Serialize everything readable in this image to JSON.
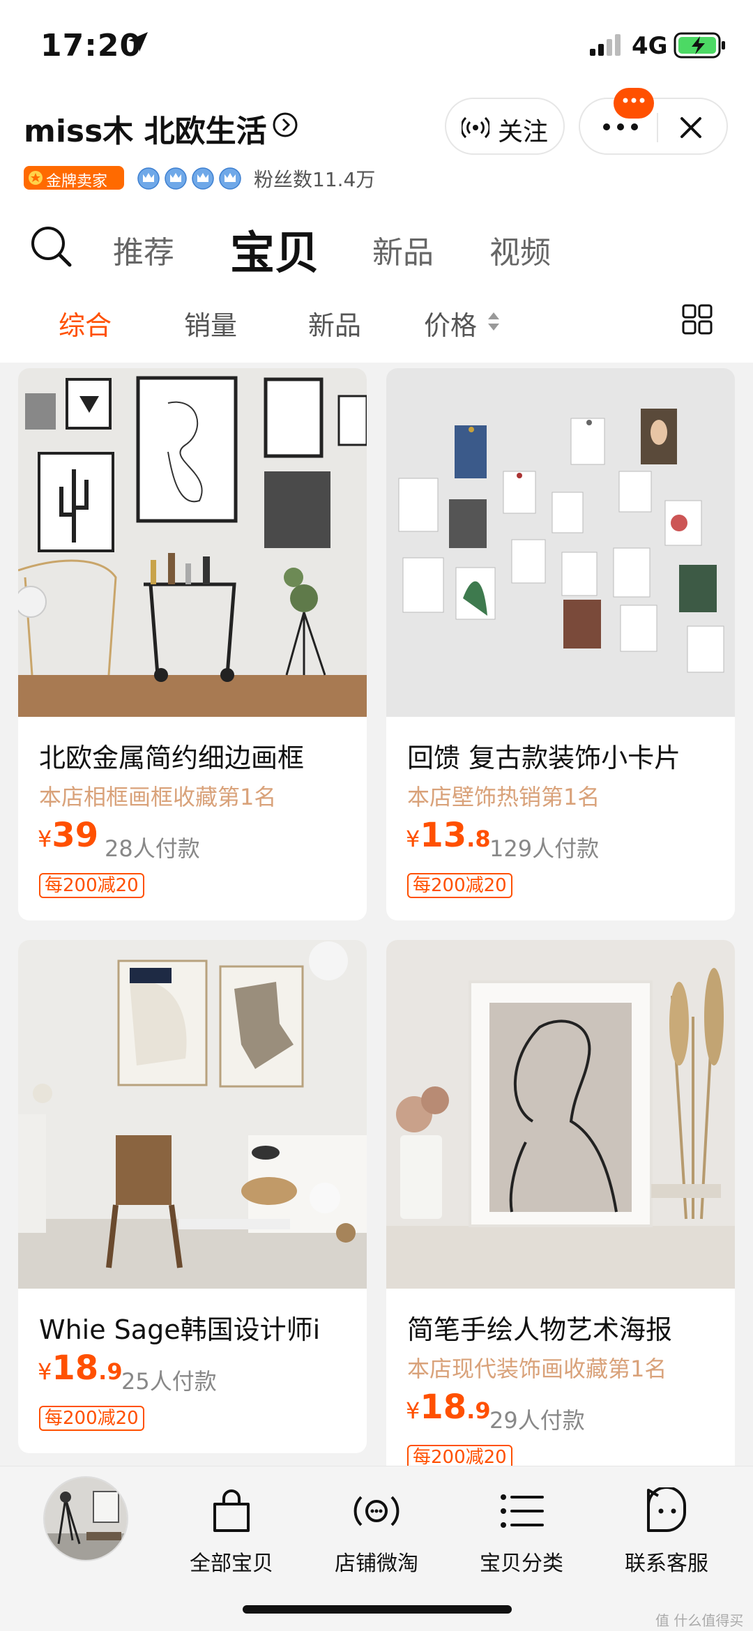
{
  "status_bar": {
    "time": "17:20",
    "network": "4G"
  },
  "shop": {
    "name": "miss木 北欧生活",
    "follow_label": "关注",
    "gold_badge": "金牌卖家",
    "fans": "粉丝数11.4万"
  },
  "main_tabs": [
    "推荐",
    "宝贝",
    "新品",
    "视频"
  ],
  "active_main_tab": "宝贝",
  "sort_tabs": [
    "综合",
    "销量",
    "新品",
    "价格"
  ],
  "active_sort_tab": "综合",
  "products": [
    {
      "title": "北欧金属简约细边画框",
      "rank": "本店相框画框收藏第1名",
      "currency": "¥",
      "price_int": "39",
      "price_dec": "",
      "sold": "28人付款",
      "promo": "每200减20"
    },
    {
      "title": "回馈 复古款装饰小卡片",
      "rank": "本店壁饰热销第1名",
      "currency": "¥",
      "price_int": "13",
      "price_dec": ".8",
      "sold": "129人付款",
      "promo": "每200减20"
    },
    {
      "title": "Whie Sage韩国设计师i",
      "rank": "",
      "currency": "¥",
      "price_int": "18",
      "price_dec": ".9",
      "sold": "25人付款",
      "promo": "每200减20"
    },
    {
      "title": "简笔手绘人物艺术海报",
      "rank": "本店现代装饰画收藏第1名",
      "currency": "¥",
      "price_int": "18",
      "price_dec": ".9",
      "sold": "29人付款",
      "promo": "每200减20"
    }
  ],
  "bottom_tabs": [
    "全部宝贝",
    "店铺微淘",
    "宝贝分类",
    "联系客服"
  ],
  "watermark": "值 什么值得买",
  "colors": {
    "accent": "#ff5000",
    "rank": "#d9a27a",
    "gold_badge": "#ff6a00"
  }
}
